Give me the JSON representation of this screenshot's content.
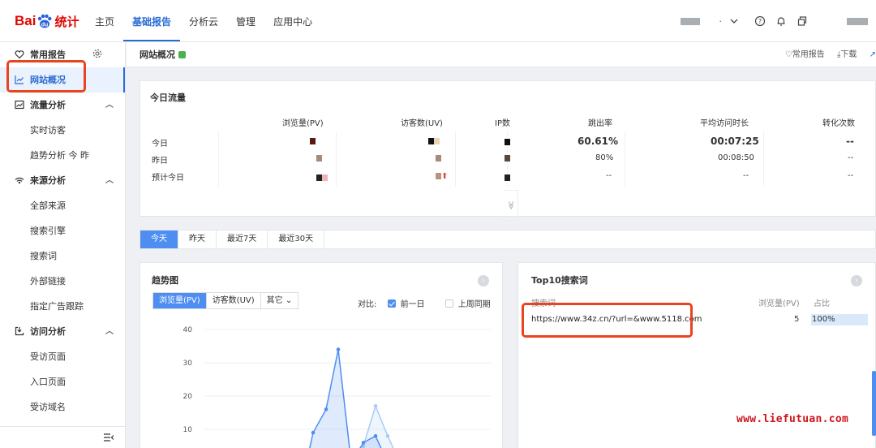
{
  "brand": {
    "logo_left": "Bai",
    "logo_mid": "du",
    "logo_right": "统计",
    "color": "#e10602"
  },
  "topnav": [
    {
      "label": "主页",
      "active": false
    },
    {
      "label": "基础报告",
      "active": true
    },
    {
      "label": "分析云",
      "active": false
    },
    {
      "label": "管理",
      "active": false
    },
    {
      "label": "应用中心",
      "active": false
    }
  ],
  "topright": {
    "separator": "·",
    "icons": [
      "help-icon",
      "bell-icon",
      "copy-icon"
    ]
  },
  "sidebar": {
    "header": {
      "label": "常用报告",
      "icon": "heart-icon"
    },
    "active_item": {
      "label": "网站概况",
      "icon": "line-chart-icon"
    },
    "groups": [
      {
        "label": "流量分析",
        "icon": "image-icon",
        "items": [
          "实时访客",
          "趋势分析 今 昨"
        ]
      },
      {
        "label": "来源分析",
        "icon": "signal-icon",
        "items": [
          "全部来源",
          "搜索引擎",
          "搜索词",
          "外部链接",
          "指定广告跟踪"
        ]
      },
      {
        "label": "访问分析",
        "icon": "enter-icon",
        "items": [
          "受访页面",
          "入口页面",
          "受访域名"
        ]
      }
    ]
  },
  "page": {
    "title": "网站概况",
    "actions": {
      "favorite": "♡常用报告",
      "download": "⤓下载",
      "more": "↗"
    }
  },
  "today_flow": {
    "title": "今日流量",
    "columns": [
      "浏览量(PV)",
      "访客数(UV)",
      "IP数",
      "跳出率",
      "平均访问时长",
      "转化次数"
    ],
    "rows": [
      {
        "label": "今日",
        "bounce": "60.61%",
        "duration": "00:07:25",
        "conversions": "--"
      },
      {
        "label": "昨日",
        "bounce": "80%",
        "duration": "00:08:50",
        "conversions": "--"
      },
      {
        "label": "预计今日",
        "bounce": "--",
        "duration": "--",
        "conversions": "--"
      }
    ],
    "expand_label": "≫"
  },
  "date_tabs": [
    {
      "label": "今天",
      "active": true
    },
    {
      "label": "昨天",
      "active": false
    },
    {
      "label": "最近7天",
      "active": false
    },
    {
      "label": "最近30天",
      "active": false
    }
  ],
  "trend": {
    "title": "趋势图",
    "metric_tabs": [
      {
        "label": "浏览量(PV)",
        "active": true
      },
      {
        "label": "访客数(UV)",
        "active": false
      },
      {
        "label": "其它 ⌄",
        "active": false
      }
    ],
    "compare_label": "对比:",
    "compare_options": [
      {
        "label": "前一日",
        "checked": true
      },
      {
        "label": "上周同期",
        "checked": false
      }
    ]
  },
  "chart_data": {
    "type": "area",
    "ylim": [
      0,
      40
    ],
    "yticks": [
      "40",
      "30",
      "20",
      "10"
    ],
    "series": [
      {
        "values": [
          0,
          9,
          16,
          34,
          0,
          6,
          8,
          0
        ],
        "color": "#4f8ef1"
      },
      {
        "values": [
          0,
          0,
          5,
          17,
          8,
          0
        ],
        "color": "#a9ccf5"
      }
    ]
  },
  "top10": {
    "title": "Top10搜索词",
    "headers": {
      "keyword": "搜索词",
      "pv": "浏览量(PV)",
      "ratio": "占比"
    },
    "rows": [
      {
        "keyword": "https://www.34z.cn/?url=&www.5118.com",
        "pv": "5",
        "ratio": "100%"
      }
    ]
  },
  "watermark": "www.liefutuan.com"
}
